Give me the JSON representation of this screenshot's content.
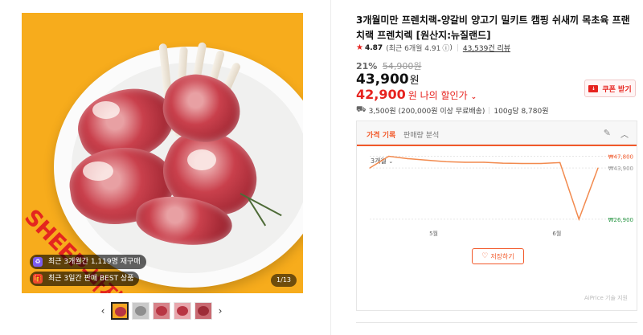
{
  "gallery": {
    "watermark": "SHEEP-바지",
    "badges": [
      {
        "text": "최근 3개월간 1,119명 재구매",
        "icon": "repurchase-icon",
        "color": "#7b5cf0"
      },
      {
        "text": "최근 3일간 판매 BEST 상품",
        "icon": "gift-icon",
        "color": "#f0492e"
      }
    ],
    "counter": "1/13",
    "prev_arrow": "‹",
    "next_arrow": "›",
    "thumbnail_count": 5
  },
  "product": {
    "title": "3개월미만 프렌치랙-양갈비 양고기 밀키트 캠핑 쉬새끼 목초육 프랜치랙 프렌치렉 [원산지:뉴질랜드]",
    "rating": {
      "star": "★",
      "score": "4.87",
      "recent": "(최근 6개월 4.91",
      "info_icon": "ⓘ",
      "recent_close": ")",
      "reviews": "43,539건 리뷰"
    },
    "discount_rate": "21%",
    "original_price": "54,900원",
    "price_number": "43,900",
    "price_unit": "원",
    "my_price_number": "42,900",
    "my_price_label": "원 나의 할인가",
    "my_price_chevron": "⌄",
    "coupon_label": "쿠폰 받기",
    "coupon_icon_text": "↓",
    "shipping": {
      "fee": "3,500원 (200,000원 이상 무료배송)",
      "unit_price": "100g당 8,780원"
    }
  },
  "price_panel": {
    "tabs": [
      "가격 기록",
      "판매량 분석"
    ],
    "period": "3개월",
    "period_chevron": "⌄",
    "save_label": "저장하기",
    "credit": "AiPrice 기술 지원",
    "accent": "#f2592a"
  },
  "chart_data": {
    "type": "line",
    "xlabel": "",
    "ylabel": "",
    "x_ticks": [
      "5월",
      "6월"
    ],
    "series": [
      {
        "values": [
          43900,
          47800,
          47000,
          46500,
          46000,
          45800,
          45800,
          45500,
          45400,
          45400,
          45700,
          26900,
          43900
        ]
      }
    ],
    "annotations": {
      "max": "₩47,800",
      "current": "₩43,900",
      "min": "₩26,900"
    },
    "ylim": [
      25000,
      49000
    ],
    "grid": false,
    "color": "#f28a4e"
  }
}
